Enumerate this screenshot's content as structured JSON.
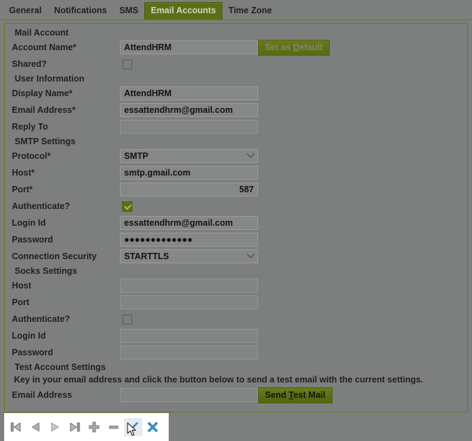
{
  "tabs": [
    {
      "label": "General",
      "active": false
    },
    {
      "label": "Notifications",
      "active": false
    },
    {
      "label": "SMS",
      "active": false
    },
    {
      "label": "Email Accounts",
      "active": true
    },
    {
      "label": "Time Zone",
      "active": false
    }
  ],
  "colors": {
    "accent_olive": "#5d6f14",
    "panel_bg": "#7d7f7e",
    "field_bg": "#868887",
    "toolbar_icon_blue": "#3f93c8",
    "nav_icon_gray": "#9a9a9a"
  },
  "groups": {
    "mail_account": {
      "title": "Mail Account",
      "account_name_label": "Account Name*",
      "account_name_value": "AttendHRM",
      "set_as_default_label": "Set as Default",
      "set_as_default_mnemonic": "D",
      "set_as_default_disabled": true,
      "shared_label": "Shared?",
      "shared_checked": false
    },
    "user_information": {
      "title": "User Information",
      "display_name_label": "Display Name*",
      "display_name_value": "AttendHRM",
      "email_address_label": "Email Address*",
      "email_address_value": "essattendhrm@gmail.com",
      "reply_to_label": "Reply To",
      "reply_to_value": ""
    },
    "smtp_settings": {
      "title": "SMTP Settings",
      "protocol_label": "Protocol*",
      "protocol_value": "SMTP",
      "host_label": "Host*",
      "host_value": "smtp.gmail.com",
      "port_label": "Port*",
      "port_value": "587",
      "authenticate_label": "Authenticate?",
      "authenticate_checked": true,
      "login_id_label": "Login Id",
      "login_id_value": "essattendhrm@gmail.com",
      "password_label": "Password",
      "password_value": "●●●●●●●●●●●●●",
      "connection_security_label": "Connection Security",
      "connection_security_value": "STARTTLS"
    },
    "socks_settings": {
      "title": "Socks Settings",
      "host_label": "Host",
      "host_value": "",
      "port_label": "Port",
      "port_value": "",
      "authenticate_label": "Authenticate?",
      "authenticate_checked": false,
      "login_id_label": "Login Id",
      "login_id_value": "",
      "password_label": "Password",
      "password_value": ""
    },
    "test_account_settings": {
      "title": "Test Account Settings",
      "hint": "Key in your email address and click the button below to send a test email with the current settings.",
      "email_address_label": "Email Address",
      "email_address_value": "",
      "send_test_mail_label": "Send Test Mail",
      "send_test_mail_mnemonic": "T"
    }
  },
  "toolbar": {
    "buttons": [
      {
        "name": "first-record",
        "icon": "first-icon"
      },
      {
        "name": "previous-record",
        "icon": "previous-icon"
      },
      {
        "name": "next-record",
        "icon": "next-icon"
      },
      {
        "name": "last-record",
        "icon": "last-icon"
      },
      {
        "name": "add-record",
        "icon": "plus-icon"
      },
      {
        "name": "delete-record",
        "icon": "minus-icon"
      },
      {
        "name": "commit-record",
        "icon": "check-icon"
      },
      {
        "name": "cancel-record",
        "icon": "cross-icon"
      }
    ]
  }
}
